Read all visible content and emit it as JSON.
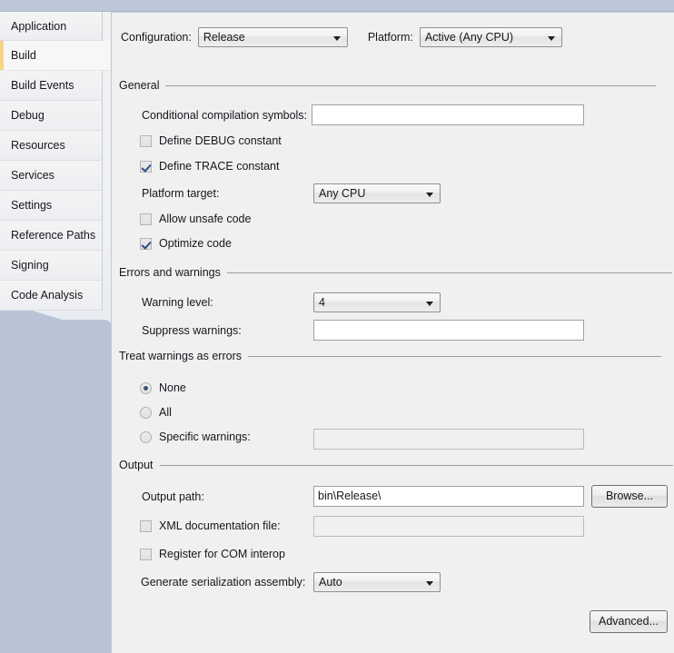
{
  "sidebar": {
    "items": [
      {
        "label": "Application",
        "selected": false
      },
      {
        "label": "Build",
        "selected": true
      },
      {
        "label": "Build Events",
        "selected": false
      },
      {
        "label": "Debug",
        "selected": false
      },
      {
        "label": "Resources",
        "selected": false
      },
      {
        "label": "Services",
        "selected": false
      },
      {
        "label": "Settings",
        "selected": false
      },
      {
        "label": "Reference Paths",
        "selected": false
      },
      {
        "label": "Signing",
        "selected": false
      },
      {
        "label": "Code Analysis",
        "selected": false
      }
    ],
    "accent_color": "#f5d58a",
    "field_color": "#b8c4d6"
  },
  "header": {
    "configuration_label": "Configuration:",
    "configuration_value": "Release",
    "platform_label": "Platform:",
    "platform_value": "Active (Any CPU)"
  },
  "general": {
    "group_label": "General",
    "conditional_symbols_label": "Conditional compilation symbols:",
    "conditional_symbols_value": "",
    "define_debug_label": "Define DEBUG constant",
    "define_debug_checked": false,
    "define_trace_label": "Define TRACE constant",
    "define_trace_checked": true,
    "platform_target_label": "Platform target:",
    "platform_target_value": "Any CPU",
    "allow_unsafe_label": "Allow unsafe code",
    "allow_unsafe_checked": false,
    "optimize_label": "Optimize code",
    "optimize_checked": true
  },
  "errors_warnings": {
    "group_label": "Errors and warnings",
    "warning_level_label": "Warning level:",
    "warning_level_value": "4",
    "suppress_warnings_label": "Suppress warnings:",
    "suppress_warnings_value": ""
  },
  "treat_warnings": {
    "group_label": "Treat warnings as errors",
    "none_label": "None",
    "none_selected": true,
    "all_label": "All",
    "all_selected": false,
    "specific_label": "Specific warnings:",
    "specific_selected": false,
    "specific_value": ""
  },
  "output": {
    "group_label": "Output",
    "output_path_label": "Output path:",
    "output_path_value": "bin\\Release\\",
    "browse_label": "Browse...",
    "xml_doc_label": "XML documentation file:",
    "xml_doc_checked": false,
    "xml_doc_value": "",
    "register_com_label": "Register for COM interop",
    "register_com_checked": false,
    "serialization_label": "Generate serialization assembly:",
    "serialization_value": "Auto",
    "advanced_label": "Advanced..."
  }
}
